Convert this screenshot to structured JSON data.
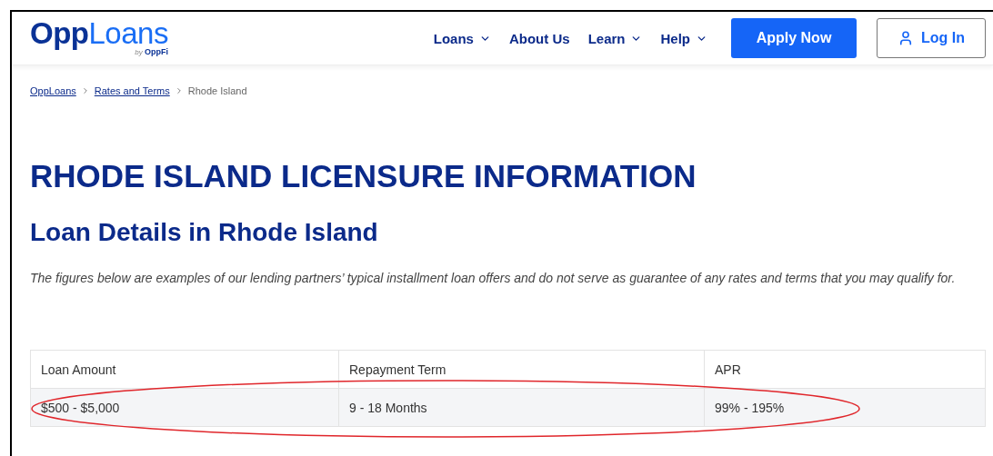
{
  "header": {
    "logo": {
      "primary": "Opp",
      "secondary": "Loans",
      "tagline_prefix": "by",
      "tagline_brand": "OppFi"
    },
    "nav": [
      {
        "label": "Loans",
        "has_menu": true
      },
      {
        "label": "About Us",
        "has_menu": false
      },
      {
        "label": "Learn",
        "has_menu": true
      },
      {
        "label": "Help",
        "has_menu": true
      }
    ],
    "apply_button": "Apply Now",
    "login_button": "Log In"
  },
  "breadcrumb": [
    {
      "label": "OppLoans",
      "link": true
    },
    {
      "label": "Rates and Terms",
      "link": true
    },
    {
      "label": "Rhode Island",
      "link": false
    }
  ],
  "title": "RHODE ISLAND LICENSURE INFORMATION",
  "subtitle": "Loan Details in Rhode Island",
  "disclaimer": "The figures below are examples of our lending partners’ typical installment loan offers and do not serve as guarantee of any rates and terms that you may qualify for.",
  "table": {
    "columns": [
      "Loan Amount",
      "Repayment Term",
      "APR"
    ],
    "rows": [
      {
        "cells": [
          "$500 - $5,000",
          "9 - 18 Months",
          "99% - 195%"
        ],
        "highlighted": true
      }
    ]
  }
}
